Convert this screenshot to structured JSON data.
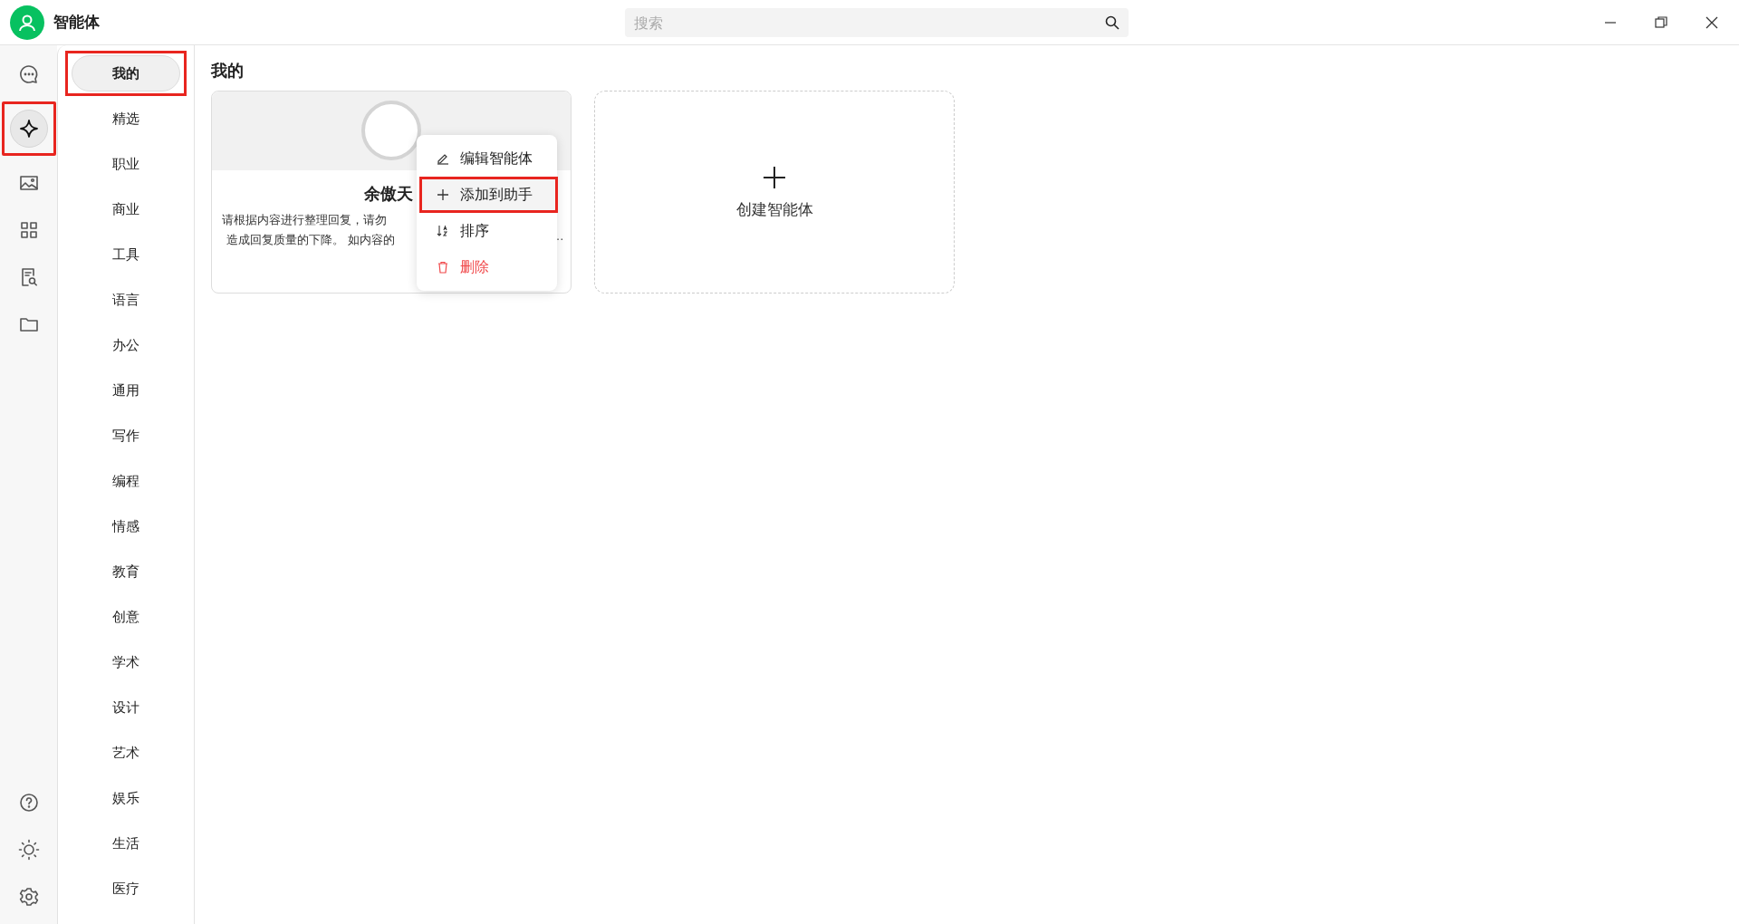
{
  "app": {
    "title": "智能体"
  },
  "search": {
    "placeholder": "搜索"
  },
  "rail": {
    "top": [
      {
        "kind": "chat",
        "selected": false,
        "highlighted": false
      },
      {
        "kind": "agent",
        "selected": true,
        "highlighted": true
      },
      {
        "kind": "image",
        "selected": false,
        "highlighted": false
      },
      {
        "kind": "apps",
        "selected": false,
        "highlighted": false
      },
      {
        "kind": "doc-search",
        "selected": false,
        "highlighted": false
      },
      {
        "kind": "folder",
        "selected": false,
        "highlighted": false
      }
    ],
    "bottom": [
      {
        "kind": "help"
      },
      {
        "kind": "theme"
      },
      {
        "kind": "settings"
      }
    ]
  },
  "categories": [
    {
      "label": "我的",
      "selected": true,
      "highlighted": true
    },
    {
      "label": "精选",
      "selected": false,
      "highlighted": false
    },
    {
      "label": "职业",
      "selected": false,
      "highlighted": false
    },
    {
      "label": "商业",
      "selected": false,
      "highlighted": false
    },
    {
      "label": "工具",
      "selected": false,
      "highlighted": false
    },
    {
      "label": "语言",
      "selected": false,
      "highlighted": false
    },
    {
      "label": "办公",
      "selected": false,
      "highlighted": false
    },
    {
      "label": "通用",
      "selected": false,
      "highlighted": false
    },
    {
      "label": "写作",
      "selected": false,
      "highlighted": false
    },
    {
      "label": "编程",
      "selected": false,
      "highlighted": false
    },
    {
      "label": "情感",
      "selected": false,
      "highlighted": false
    },
    {
      "label": "教育",
      "selected": false,
      "highlighted": false
    },
    {
      "label": "创意",
      "selected": false,
      "highlighted": false
    },
    {
      "label": "学术",
      "selected": false,
      "highlighted": false
    },
    {
      "label": "设计",
      "selected": false,
      "highlighted": false
    },
    {
      "label": "艺术",
      "selected": false,
      "highlighted": false
    },
    {
      "label": "娱乐",
      "selected": false,
      "highlighted": false
    },
    {
      "label": "生活",
      "selected": false,
      "highlighted": false
    },
    {
      "label": "医疗",
      "selected": false,
      "highlighted": false
    }
  ],
  "section_title": "我的",
  "agents": [
    {
      "name": "余傲天",
      "description_lines": [
        "请根据内容进行整理回复，请勿",
        "造成回复质量的下降。 如内容的"
      ],
      "overflow_mark": "..",
      "menu": [
        {
          "label": "编辑智能体",
          "kind": "edit",
          "highlighted": false
        },
        {
          "label": "添加到助手",
          "kind": "add",
          "highlighted": true
        },
        {
          "label": "排序",
          "kind": "sort",
          "highlighted": false
        },
        {
          "label": "删除",
          "kind": "delete",
          "highlighted": false
        }
      ]
    }
  ],
  "create_card": {
    "label": "创建智能体"
  }
}
